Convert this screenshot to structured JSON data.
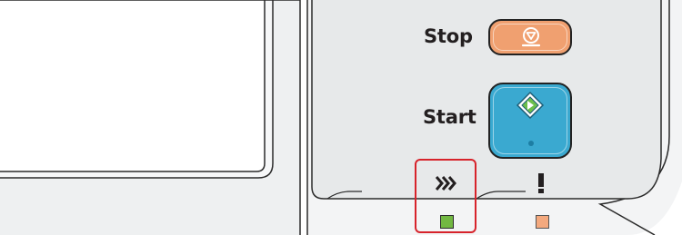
{
  "panel": {
    "stop_label": "Stop",
    "start_label": "Start"
  },
  "icons": {
    "stop": "stop-icon",
    "start": "start-diamond-icon",
    "processing": "processing-chevrons-icon",
    "attention": "attention-exclamation-icon"
  },
  "indicators": {
    "processing_led_color": "#72b842",
    "attention_led_color": "#f4a97e",
    "highlight_color": "#d7232b"
  },
  "colors": {
    "stop_button": "#f0a070",
    "start_button": "#3aa9d0",
    "panel_surface": "#e9ebec"
  }
}
